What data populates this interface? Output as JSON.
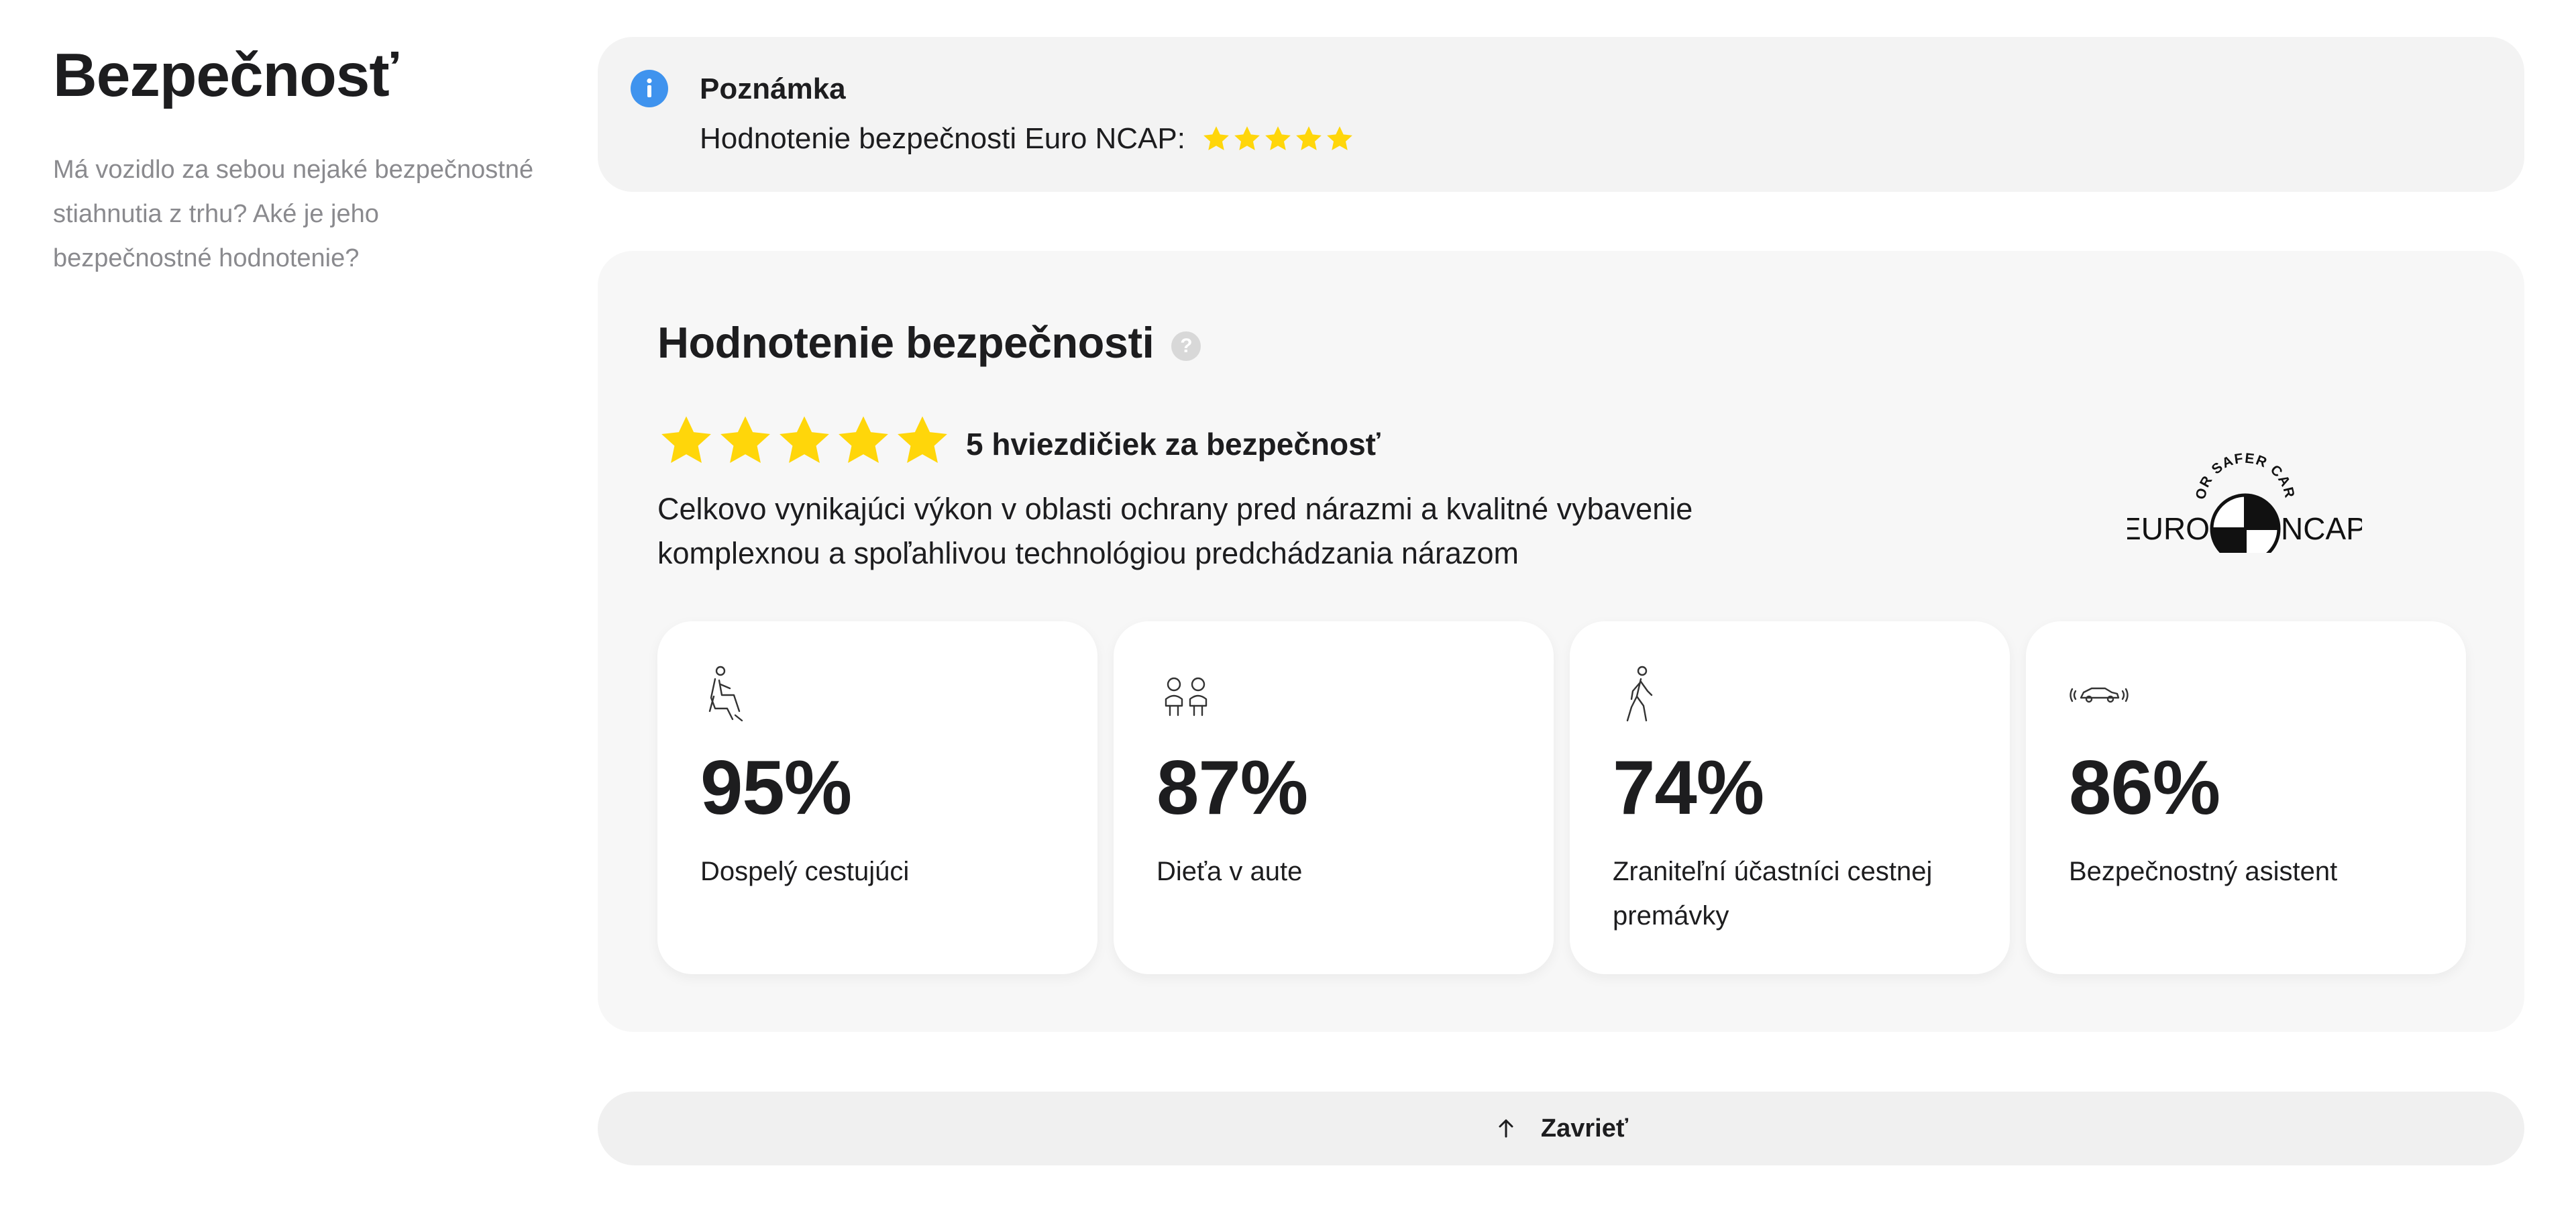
{
  "left": {
    "title": "Bezpečnosť",
    "description": "Má vozidlo za sebou nejaké bezpečnostné stiahnutia z trhu? Aké je jeho bezpečnostné hodnotenie?"
  },
  "note": {
    "icon": "info-icon",
    "title": "Poznámka",
    "text": "Hodnotenie bezpečnosti Euro NCAP:",
    "stars": 5
  },
  "safety": {
    "title": "Hodnotenie bezpečnosti",
    "help_icon": "help-icon",
    "help_glyph": "?",
    "stars": 5,
    "stars_label": "5 hviezdičiek za bezpečnosť",
    "description": "Celkovo vynikajúci výkon v oblasti ochrany pred nárazmi a kvalitné vybavenie komplexnou a spoľahlivou technológiou predchádzania nárazom",
    "logo": {
      "arc_text": "FOR SAFER CARS",
      "left_text": "EURO",
      "right_text": "NCAP"
    },
    "metrics": [
      {
        "icon": "seated-adult-icon",
        "value": "95%",
        "label": "Dospelý cestujúci"
      },
      {
        "icon": "children-icon",
        "value": "87%",
        "label": "Dieťa v aute"
      },
      {
        "icon": "pedestrian-icon",
        "value": "74%",
        "label": "Zraniteľní účastníci cestnej premávky"
      },
      {
        "icon": "car-sensor-icon",
        "value": "86%",
        "label": "Bezpečnostný asistent"
      }
    ]
  },
  "close_button": {
    "icon": "arrow-up-icon",
    "label": "Zavrieť"
  },
  "colors": {
    "star": "#ffd60a",
    "info": "#3f93ee",
    "text": "#1d1d1f",
    "muted": "#8a8a8e"
  }
}
